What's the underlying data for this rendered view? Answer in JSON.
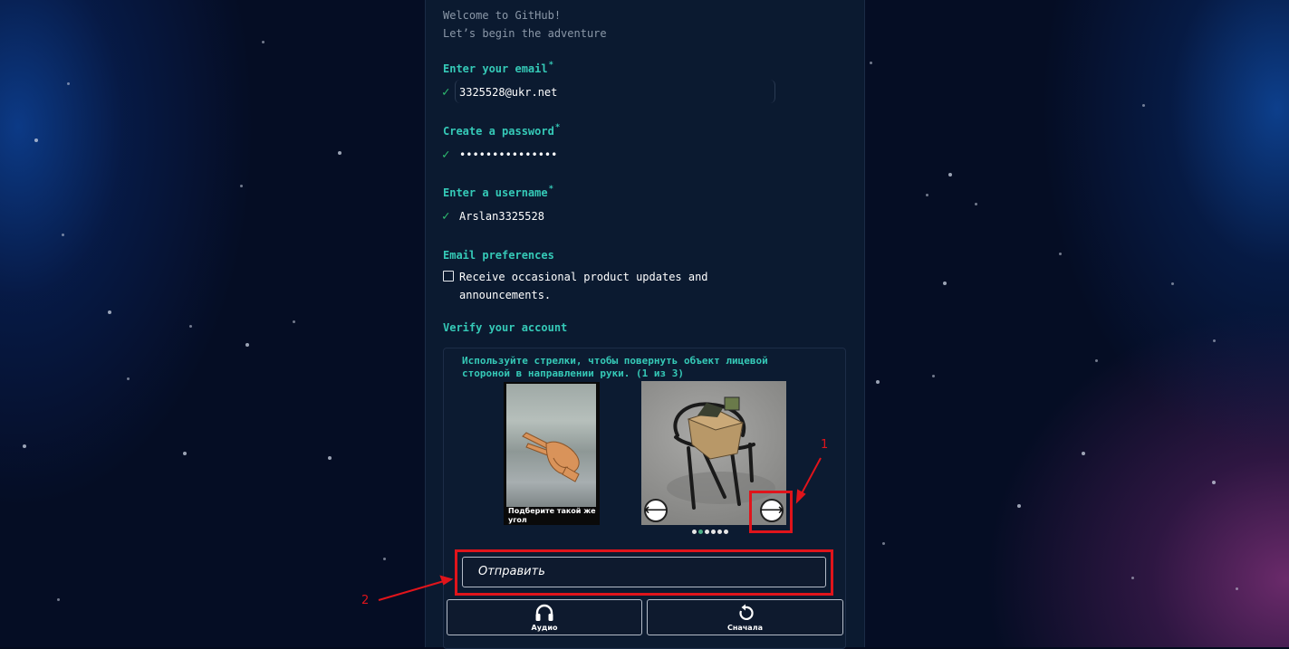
{
  "welcome": {
    "line1": "Welcome to GitHub!",
    "line2": "Let’s begin the adventure"
  },
  "form": {
    "email": {
      "label": "Enter your email",
      "required_mark": "*",
      "value": "3325528@ukr.net",
      "valid_icon": "check-icon"
    },
    "password": {
      "label": "Create a password",
      "required_mark": "*",
      "value": "•••••••••••••••",
      "valid_icon": "check-icon"
    },
    "username": {
      "label": "Enter a username",
      "required_mark": "*",
      "value": "Arslan3325528",
      "valid_icon": "check-icon"
    },
    "email_preferences": {
      "label": "Email preferences",
      "checkbox_text": "Receive occasional product updates and announcements.",
      "checked": false
    },
    "verify_label": "Verify your account"
  },
  "captcha": {
    "instruction": "Используйте стрелки, чтобы повернуть объект лицевой стороной в направлении руки. (1 из 3)",
    "reference_caption": "Подберите такой же угол",
    "left_arrow_icon": "arrow-left-icon",
    "right_arrow_icon": "arrow-right-icon",
    "pager": {
      "count": 6,
      "active_index": 1
    },
    "submit_label": "Отправить",
    "audio_label": "Аудио",
    "restart_label": "Сначала"
  },
  "annotations": {
    "marker_1": "1",
    "marker_2": "2",
    "color": "#e0141b"
  },
  "colors": {
    "accent": "#35c9b7",
    "valid": "#2fbf71",
    "panel": "#0b1a30"
  }
}
